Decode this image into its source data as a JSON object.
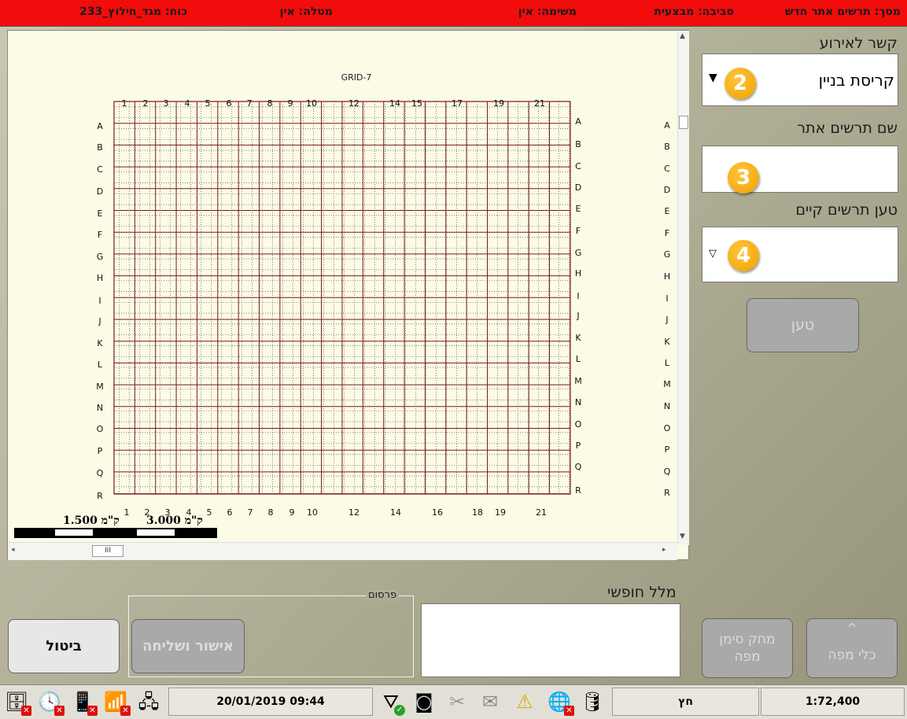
{
  "top_bar": {
    "screen": "מסך: תרשים אתר חדש",
    "environment": "סביבה: מבצעית",
    "task": "משימה: אין",
    "mission": "מטלה: אין",
    "force": "כוח: מגד_חילוץ_233"
  },
  "map": {
    "grid_title": "GRID-7",
    "top_col_labels": [
      "1",
      "2",
      "3",
      "4",
      "5",
      "6",
      "7",
      "8",
      "9",
      "10",
      "12",
      "14",
      "15",
      "17",
      "19",
      "21"
    ],
    "bottom_col_labels": [
      "1",
      "2",
      "3",
      "4",
      "5",
      "6",
      "7",
      "8",
      "9",
      "10",
      "12",
      "14",
      "16",
      "18",
      "19",
      "21"
    ],
    "row_labels": [
      "A",
      "B",
      "C",
      "D",
      "E",
      "F",
      "G",
      "H",
      "I",
      "J",
      "K",
      "L",
      "M",
      "N",
      "O",
      "P",
      "Q",
      "R"
    ],
    "scale_label_1": "1.500 ק\"מ",
    "scale_label_2": "3.000 ק\"מ",
    "hscroll_thumb": "III"
  },
  "right_panel": {
    "event_link_label": "קשר לאירוע",
    "event_link_value": "קריסת בניין",
    "site_name_label": "שם תרשים אתר",
    "site_name_value": "",
    "load_existing_label": "טען תרשים קיים",
    "load_existing_value": "",
    "load_button": "טען",
    "badges": [
      "2",
      "3",
      "4"
    ]
  },
  "bottom": {
    "free_text_label": "מלל חופשי",
    "publish_group_label": "פרסום",
    "approve_send_button": "אישור ושליחה",
    "cancel_button": "ביטול",
    "delete_marker_button_line1": "מחק סימן",
    "delete_marker_button_line2": "מפה",
    "map_tools_button": "כלי מפה",
    "map_tools_chevron": "^"
  },
  "taskbar": {
    "datetime": "20/01/2019 09:44",
    "arrow_label": "חץ",
    "scale": "1:72,400"
  },
  "colors": {
    "top_bar": "#f20c0c",
    "map_background": "#fbfbe6",
    "grid_line": "#7a1a1a",
    "badge": "#f5a800"
  },
  "icons": [
    "database-icon",
    "clock-icon",
    "phone-icon",
    "wireless-icon",
    "network-icon",
    "filter-icon",
    "camera-icon",
    "tools-icon",
    "mail-icon",
    "warning-icon",
    "globe-icon",
    "vault-icon"
  ]
}
